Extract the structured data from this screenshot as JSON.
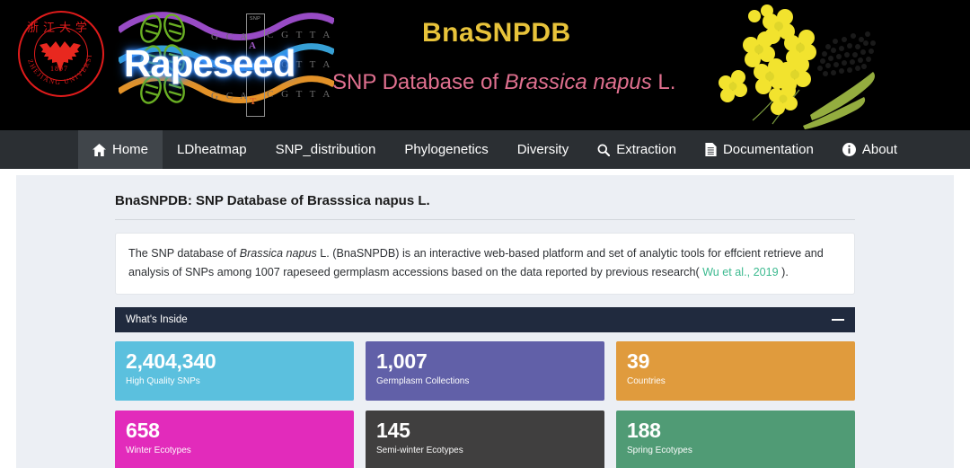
{
  "banner": {
    "logo_alt": "Zhejiang University",
    "logo_year": "1897",
    "logo_chinese": "浙江大学",
    "logo_english": "ZHEJIANG UNIVERSITY",
    "art_word": "Rapeseed",
    "snp_box_label": "SNP",
    "snp_allele_top": "A",
    "snp_allele_bottom": "T",
    "dna_sequence_left": "G C A",
    "dna_sequence_right": "C G T T A G A",
    "title": "BnaSNPDB",
    "subtitle_prefix": "SNP Database of ",
    "subtitle_italic": "Brassica napus",
    "subtitle_suffix": " L."
  },
  "nav": {
    "items": [
      {
        "label": "Home",
        "icon": "home-icon",
        "active": true
      },
      {
        "label": "LDheatmap",
        "icon": "",
        "active": false
      },
      {
        "label": "SNP_distribution",
        "icon": "",
        "active": false
      },
      {
        "label": "Phylogenetics",
        "icon": "",
        "active": false
      },
      {
        "label": "Diversity",
        "icon": "",
        "active": false
      },
      {
        "label": "Extraction",
        "icon": "search-icon",
        "active": false
      },
      {
        "label": "Documentation",
        "icon": "document-icon",
        "active": false
      },
      {
        "label": "About",
        "icon": "info-icon",
        "active": false
      }
    ]
  },
  "main": {
    "page_title": "BnaSNPDB: SNP Database of Brasssica napus L.",
    "description": {
      "part1": "The SNP database of ",
      "italic1": "Brassica napus",
      "part2": " L. (BnaSNPDB) is an interactive web-based platform and set of analytic tools for effcient retrieve and analysis of SNPs among 1007 rapeseed germplasm accessions based on the data reported by previous research( ",
      "link": "Wu et al., 2019",
      "part3": " )."
    },
    "panel": {
      "title": "What's Inside",
      "collapse_icon": "minus-icon",
      "stats": [
        {
          "value": "2,404,340",
          "label": "High Quality SNPs",
          "color": "#5bc0de"
        },
        {
          "value": "1,007",
          "label": "Germplasm Collections",
          "color": "#6160a8"
        },
        {
          "value": "39",
          "label": "Countries",
          "color": "#e09b3d"
        },
        {
          "value": "658",
          "label": "Winter Ecotypes",
          "color": "#e22bbb"
        },
        {
          "value": "145",
          "label": "Semi-winter Ecotypes",
          "color": "#403f3f"
        },
        {
          "value": "188",
          "label": "Spring Ecotypes",
          "color": "#509b75"
        }
      ]
    }
  },
  "colors": {
    "banner_bg": "#000000",
    "nav_bg": "#2b2f33",
    "nav_active_bg": "#40454a",
    "page_bg": "#eceff4",
    "panel_head_bg": "#202a3e",
    "title_yellow": "#e8c33a",
    "subtitle_pink": "#e0708f",
    "link_teal": "#3dba90",
    "seal_red": "#e01b1b"
  }
}
